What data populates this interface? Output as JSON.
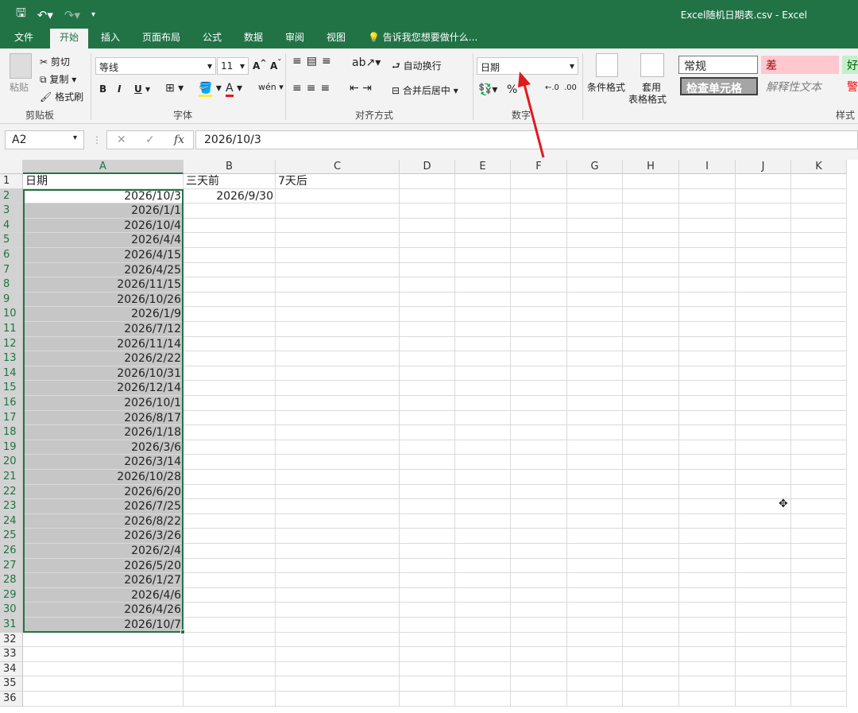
{
  "window": {
    "title": "Excel随机日期表.csv - Excel",
    "qat": {
      "save_icon": "save-icon",
      "undo_icon": "undo-icon",
      "redo_icon": "redo-icon",
      "customize_icon": "customize-icon"
    }
  },
  "tabs": [
    "文件",
    "开始",
    "插入",
    "页面布局",
    "公式",
    "数据",
    "审阅",
    "视图"
  ],
  "tell_me": "告诉我您想要做什么...",
  "ribbon": {
    "clipboard": {
      "paste": "粘贴",
      "cut": "剪切",
      "copy": "复制",
      "format_painter": "格式刷",
      "group": "剪贴板"
    },
    "font": {
      "name": "等线",
      "size": "11",
      "bold": "B",
      "italic": "I",
      "underline": "U",
      "group": "字体"
    },
    "alignment": {
      "wrap": "自动换行",
      "merge": "合并后居中",
      "group": "对齐方式"
    },
    "number": {
      "format": "日期",
      "percent": "%",
      "group": "数字"
    },
    "styles": {
      "conditional": "条件格式",
      "table_line1": "套用",
      "table_line2": "表格格式",
      "normal": "常规",
      "bad": "差",
      "good": "好",
      "check_cell": "检查单元格",
      "explanatory": "解释性文本",
      "warning": "警",
      "group": "样式"
    }
  },
  "formula_bar": {
    "name_box": "A2",
    "fx": "fx",
    "value": "2026/10/3"
  },
  "sheet": {
    "columns": [
      "A",
      "B",
      "C",
      "D",
      "E",
      "F",
      "G",
      "H",
      "I",
      "J",
      "K"
    ],
    "rows": [
      "1",
      "2",
      "3",
      "4",
      "5",
      "6",
      "7",
      "8",
      "9",
      "10",
      "11",
      "12",
      "13",
      "14",
      "15",
      "16",
      "17",
      "18",
      "19",
      "20",
      "21",
      "22",
      "23",
      "24",
      "25",
      "26",
      "27",
      "28",
      "29",
      "30",
      "31",
      "32",
      "33",
      "34",
      "35",
      "36"
    ],
    "header_row": {
      "A": "日期",
      "B": "三天前",
      "C": "7天后"
    },
    "b2": "2026/9/30",
    "dates": [
      "2026/10/3",
      "2026/1/1",
      "2026/10/4",
      "2026/4/4",
      "2026/4/15",
      "2026/4/25",
      "2026/11/15",
      "2026/10/26",
      "2026/1/9",
      "2026/7/12",
      "2026/11/14",
      "2026/2/22",
      "2026/10/31",
      "2026/12/14",
      "2026/10/1",
      "2026/8/17",
      "2026/1/18",
      "2026/3/6",
      "2026/3/14",
      "2026/10/28",
      "2026/6/20",
      "2026/7/25",
      "2026/8/22",
      "2026/3/26",
      "2026/2/4",
      "2026/5/20",
      "2026/1/27",
      "2026/4/6",
      "2026/4/26",
      "2026/10/7"
    ]
  },
  "colors": {
    "brand": "#217346",
    "selection": "#c6c6c6",
    "arrow": "#e0191d"
  }
}
